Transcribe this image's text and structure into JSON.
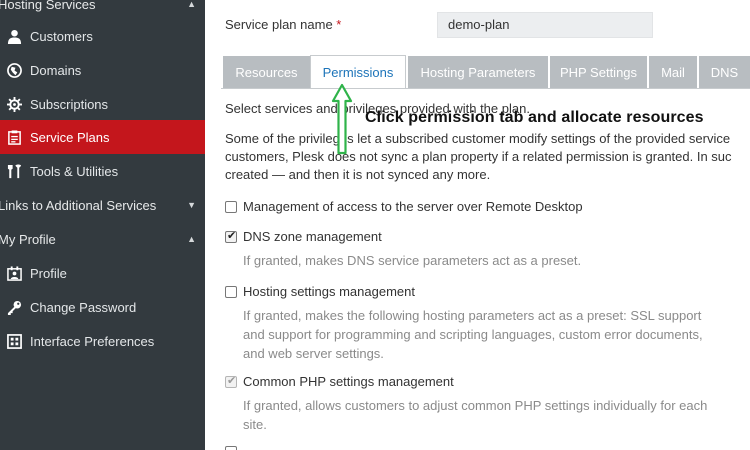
{
  "sidebar": {
    "group_hosting": "Hosting Services",
    "items": [
      {
        "label": "Customers",
        "icon": "customers-icon"
      },
      {
        "label": "Domains",
        "icon": "globe-icon"
      },
      {
        "label": "Subscriptions",
        "icon": "subscriptions-icon"
      },
      {
        "label": "Service Plans",
        "icon": "service-plans-icon",
        "active": true
      },
      {
        "label": "Tools & Utilities",
        "icon": "tools-icon"
      }
    ],
    "group_links": "Links to Additional Services",
    "group_profile": "My Profile",
    "profile_items": [
      {
        "label": "Profile",
        "icon": "profile-icon"
      },
      {
        "label": "Change Password",
        "icon": "key-icon"
      },
      {
        "label": "Interface Preferences",
        "icon": "interface-icon"
      }
    ]
  },
  "form": {
    "plan_name_label": "Service plan name",
    "required_mark": "*",
    "plan_name_value": "demo-plan"
  },
  "tabs": [
    "Resources",
    "Permissions",
    "Hosting Parameters",
    "PHP Settings",
    "Mail",
    "DNS"
  ],
  "active_tab": "Permissions",
  "content": {
    "intro": "Select services and privileges provided with the plan.",
    "para_lines": [
      "Some of the privileges let a subscribed customer modify settings of the provided service",
      "customers, Plesk does not sync a plan property if a related permission is granted. In suc",
      "created — and then it is not synced any more."
    ]
  },
  "annotation": "Click permission tab and allocate resources",
  "permissions": [
    {
      "label": "Management of access to the server over Remote Desktop",
      "checked": false,
      "hint": []
    },
    {
      "label": "DNS zone management",
      "checked": true,
      "hint": [
        "If granted, makes DNS service parameters act as a preset."
      ]
    },
    {
      "label": "Hosting settings management",
      "checked": false,
      "hint": [
        "If granted, makes the following hosting parameters act as a preset: SSL support",
        "and support for programming and scripting languages, custom error documents,",
        "and web server settings."
      ]
    },
    {
      "label": "Common PHP settings management",
      "checked": true,
      "disabled": true,
      "hint": [
        "If granted, allows customers to adjust common PHP settings individually for each",
        "site."
      ]
    }
  ],
  "colors": {
    "sidebar_bg": "#333a3f",
    "active_red": "#c4161c",
    "tab_grey": "#b8bdc1",
    "link_blue": "#1d74b9",
    "arrow_green": "#2fb34a"
  }
}
